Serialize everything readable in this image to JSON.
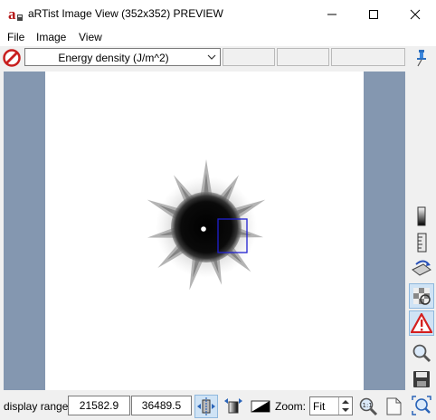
{
  "window": {
    "title": "aRTist Image View (352x352) PREVIEW",
    "app_icon_letter": "a",
    "controls": [
      "minimize-icon",
      "maximize-icon",
      "close-icon"
    ]
  },
  "menu": {
    "items": [
      {
        "label": "File"
      },
      {
        "label": "Image"
      },
      {
        "label": "View"
      }
    ]
  },
  "toolbar": {
    "field_selected": "Energy density (J/m^2)",
    "icons": [
      "stop-icon",
      "pin-icon"
    ]
  },
  "sidebar": {
    "icons": [
      "gradient-bar-icon",
      "ruler-icon",
      "rotate-image-icon",
      "checker-pattern-icon",
      "warning-icon",
      "zoom-icon",
      "save-icon"
    ],
    "active": [
      "checker-pattern-icon",
      "warning-icon"
    ]
  },
  "status": {
    "range_label": "display range",
    "range_min": "21582.9",
    "range_max": "36489.5",
    "zoom_label": "Zoom:",
    "zoom_value": "Fit"
  },
  "colors": {
    "canvas_background": "#8497b0",
    "image_background": "#ffffff",
    "selection_box": "#2020d0",
    "warning": "#d42020"
  }
}
